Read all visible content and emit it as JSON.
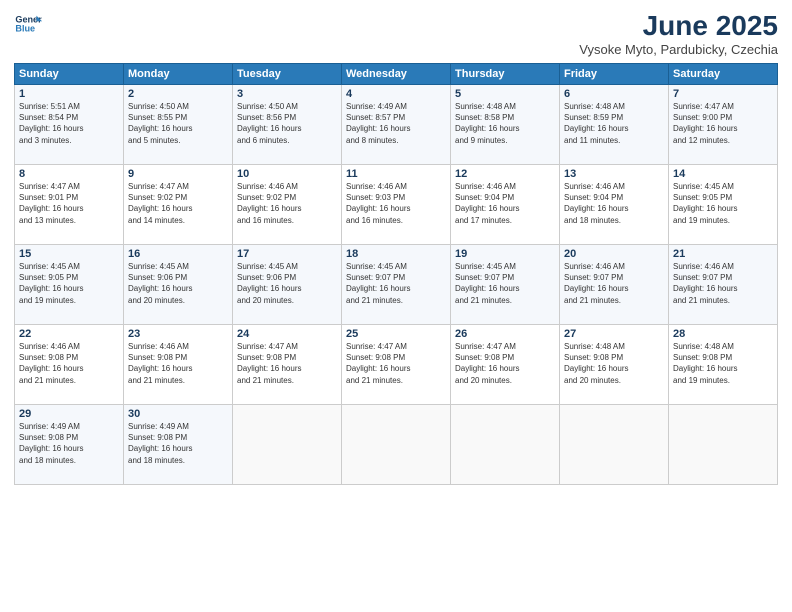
{
  "header": {
    "logo_line1": "General",
    "logo_line2": "Blue",
    "month": "June 2025",
    "location": "Vysoke Myto, Pardubicky, Czechia"
  },
  "weekdays": [
    "Sunday",
    "Monday",
    "Tuesday",
    "Wednesday",
    "Thursday",
    "Friday",
    "Saturday"
  ],
  "weeks": [
    [
      {
        "day": 1,
        "sunrise": "5:51 AM",
        "sunset": "8:54 PM",
        "daylight": "16 hours and 3 minutes."
      },
      {
        "day": 2,
        "sunrise": "4:50 AM",
        "sunset": "8:55 PM",
        "daylight": "16 hours and 5 minutes."
      },
      {
        "day": 3,
        "sunrise": "4:50 AM",
        "sunset": "8:56 PM",
        "daylight": "16 hours and 6 minutes."
      },
      {
        "day": 4,
        "sunrise": "4:49 AM",
        "sunset": "8:57 PM",
        "daylight": "16 hours and 8 minutes."
      },
      {
        "day": 5,
        "sunrise": "4:48 AM",
        "sunset": "8:58 PM",
        "daylight": "16 hours and 9 minutes."
      },
      {
        "day": 6,
        "sunrise": "4:48 AM",
        "sunset": "8:59 PM",
        "daylight": "16 hours and 11 minutes."
      },
      {
        "day": 7,
        "sunrise": "4:47 AM",
        "sunset": "9:00 PM",
        "daylight": "16 hours and 12 minutes."
      }
    ],
    [
      {
        "day": 8,
        "sunrise": "4:47 AM",
        "sunset": "9:01 PM",
        "daylight": "16 hours and 13 minutes."
      },
      {
        "day": 9,
        "sunrise": "4:47 AM",
        "sunset": "9:02 PM",
        "daylight": "16 hours and 14 minutes."
      },
      {
        "day": 10,
        "sunrise": "4:46 AM",
        "sunset": "9:02 PM",
        "daylight": "16 hours and 16 minutes."
      },
      {
        "day": 11,
        "sunrise": "4:46 AM",
        "sunset": "9:03 PM",
        "daylight": "16 hours and 16 minutes."
      },
      {
        "day": 12,
        "sunrise": "4:46 AM",
        "sunset": "9:04 PM",
        "daylight": "16 hours and 17 minutes."
      },
      {
        "day": 13,
        "sunrise": "4:46 AM",
        "sunset": "9:04 PM",
        "daylight": "16 hours and 18 minutes."
      },
      {
        "day": 14,
        "sunrise": "4:45 AM",
        "sunset": "9:05 PM",
        "daylight": "16 hours and 19 minutes."
      }
    ],
    [
      {
        "day": 15,
        "sunrise": "4:45 AM",
        "sunset": "9:05 PM",
        "daylight": "16 hours and 19 minutes."
      },
      {
        "day": 16,
        "sunrise": "4:45 AM",
        "sunset": "9:06 PM",
        "daylight": "16 hours and 20 minutes."
      },
      {
        "day": 17,
        "sunrise": "4:45 AM",
        "sunset": "9:06 PM",
        "daylight": "16 hours and 20 minutes."
      },
      {
        "day": 18,
        "sunrise": "4:45 AM",
        "sunset": "9:07 PM",
        "daylight": "16 hours and 21 minutes."
      },
      {
        "day": 19,
        "sunrise": "4:45 AM",
        "sunset": "9:07 PM",
        "daylight": "16 hours and 21 minutes."
      },
      {
        "day": 20,
        "sunrise": "4:46 AM",
        "sunset": "9:07 PM",
        "daylight": "16 hours and 21 minutes."
      },
      {
        "day": 21,
        "sunrise": "4:46 AM",
        "sunset": "9:07 PM",
        "daylight": "16 hours and 21 minutes."
      }
    ],
    [
      {
        "day": 22,
        "sunrise": "4:46 AM",
        "sunset": "9:08 PM",
        "daylight": "16 hours and 21 minutes."
      },
      {
        "day": 23,
        "sunrise": "4:46 AM",
        "sunset": "9:08 PM",
        "daylight": "16 hours and 21 minutes."
      },
      {
        "day": 24,
        "sunrise": "4:47 AM",
        "sunset": "9:08 PM",
        "daylight": "16 hours and 21 minutes."
      },
      {
        "day": 25,
        "sunrise": "4:47 AM",
        "sunset": "9:08 PM",
        "daylight": "16 hours and 21 minutes."
      },
      {
        "day": 26,
        "sunrise": "4:47 AM",
        "sunset": "9:08 PM",
        "daylight": "16 hours and 20 minutes."
      },
      {
        "day": 27,
        "sunrise": "4:48 AM",
        "sunset": "9:08 PM",
        "daylight": "16 hours and 20 minutes."
      },
      {
        "day": 28,
        "sunrise": "4:48 AM",
        "sunset": "9:08 PM",
        "daylight": "16 hours and 19 minutes."
      }
    ],
    [
      {
        "day": 29,
        "sunrise": "4:49 AM",
        "sunset": "9:08 PM",
        "daylight": "16 hours and 18 minutes."
      },
      {
        "day": 30,
        "sunrise": "4:49 AM",
        "sunset": "9:08 PM",
        "daylight": "16 hours and 18 minutes."
      },
      null,
      null,
      null,
      null,
      null
    ]
  ]
}
